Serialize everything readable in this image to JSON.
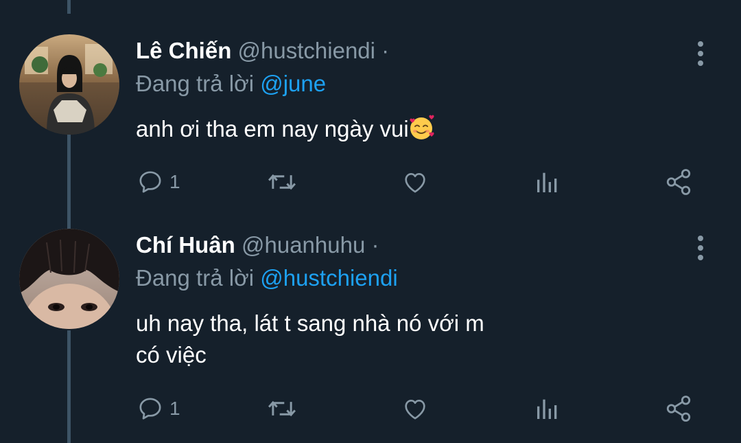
{
  "tweets": [
    {
      "display_name": "Lê Chiến",
      "handle": "@hustchiendi",
      "separator": "·",
      "reply_prefix": "Đang trả lời",
      "reply_to": "@june",
      "text": "anh ơi tha em nay ngày vui",
      "emoji": "smiling-face-with-hearts",
      "reply_count": "1"
    },
    {
      "display_name": "Chí Huân",
      "handle": "@huanhuhu",
      "separator": "·",
      "reply_prefix": "Đang trả lời",
      "reply_to": "@hustchiendi",
      "text_lines": [
        "uh nay tha, lát t sang nhà nó với m",
        "có việc"
      ],
      "reply_count": "1"
    }
  ],
  "colors": {
    "background": "#15202b",
    "muted": "#8899a6",
    "accent": "#1da1f2",
    "thread_line": "#3d5466"
  },
  "icons": [
    "reply-icon",
    "retweet-icon",
    "like-icon",
    "stats-icon",
    "share-icon",
    "more-icon"
  ]
}
